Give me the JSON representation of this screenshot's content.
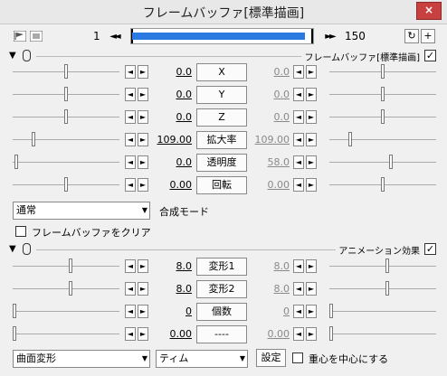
{
  "window": {
    "title": "フレームバッファ[標準描画]",
    "close_label": "×"
  },
  "toolbar": {
    "frame_start": "1",
    "frame_end": "150",
    "timeline_progress": 0.98
  },
  "section1": {
    "label": "フレームバッファ[標準描画]",
    "checked": "✓",
    "rows": [
      {
        "name": "x",
        "label": "X",
        "value_start": "0.0",
        "value_end": "0.0",
        "slider_fraction": 0.5,
        "slider2_fraction": 0.5
      },
      {
        "name": "y",
        "label": "Y",
        "value_start": "0.0",
        "value_end": "0.0",
        "slider_fraction": 0.5,
        "slider2_fraction": 0.5
      },
      {
        "name": "z",
        "label": "Z",
        "value_start": "0.0",
        "value_end": "0.0",
        "slider_fraction": 0.5,
        "slider2_fraction": 0.5
      },
      {
        "name": "scale",
        "label": "拡大率",
        "value_start": "109.00",
        "value_end": "109.00",
        "slider_fraction": 0.18,
        "slider2_fraction": 0.18
      },
      {
        "name": "opacity",
        "label": "透明度",
        "value_start": "0.0",
        "value_end": "58.0",
        "slider_fraction": 0.02,
        "slider2_fraction": 0.58
      },
      {
        "name": "rotation",
        "label": "回転",
        "value_start": "0.00",
        "value_end": "0.00",
        "slider_fraction": 0.5,
        "slider2_fraction": 0.5
      }
    ],
    "blend_mode": "通常",
    "blend_mode_label": "合成モード",
    "clear_buffer_label": "フレームバッファをクリア"
  },
  "section2": {
    "label": "アニメーション効果",
    "checked": "✓",
    "rows": [
      {
        "name": "deform1",
        "label": "変形1",
        "value_start": "8.0",
        "value_end": "8.0",
        "slider_fraction": 0.54,
        "slider2_fraction": 0.54
      },
      {
        "name": "deform2",
        "label": "変形2",
        "value_start": "8.0",
        "value_end": "8.0",
        "slider_fraction": 0.54,
        "slider2_fraction": 0.54
      },
      {
        "name": "count",
        "label": "個数",
        "value_start": "0",
        "value_end": "0",
        "slider_fraction": 0.0,
        "slider2_fraction": 0.0
      },
      {
        "name": "empty",
        "label": "----",
        "value_start": "0.00",
        "value_end": "0.00",
        "slider_fraction": 0.0,
        "slider2_fraction": 0.0
      }
    ],
    "effect_type": "曲面変形",
    "preset": "ティム",
    "settings_label": "設定",
    "center_of_gravity_label": "重心を中心にする"
  },
  "icons": {
    "left": "◄",
    "right": "►",
    "prev": "◄◄",
    "next": "►►",
    "down": "▼"
  }
}
